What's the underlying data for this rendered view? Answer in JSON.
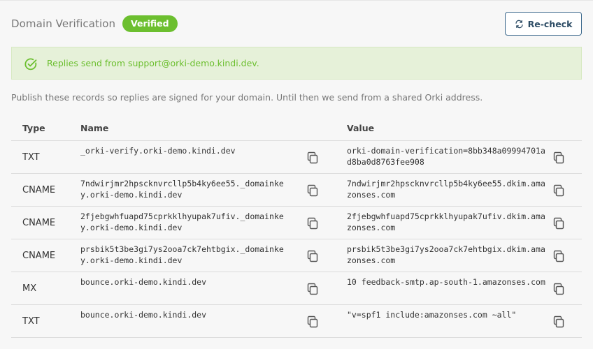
{
  "header": {
    "title": "Domain Verification",
    "status_badge": "Verified",
    "recheck_label": "Re-check"
  },
  "alert": {
    "message": "Replies send from support@orki-demo.kindi.dev."
  },
  "description": "Publish these records so replies are signed for your domain. Until then we send from a shared Orki address.",
  "table": {
    "columns": {
      "type": "Type",
      "name": "Name",
      "value": "Value"
    },
    "rows": [
      {
        "type": "TXT",
        "name": "_orki-verify.orki-demo.kindi.dev",
        "value": "orki-domain-verification=8bb348a09994701ad8ba0d8763fee908"
      },
      {
        "type": "CNAME",
        "name": "7ndwirjmr2hpscknvrcllp5b4ky6ee55._domainkey.orki-demo.kindi.dev",
        "value": "7ndwirjmr2hpscknvrcllp5b4ky6ee55.dkim.amazonses.com"
      },
      {
        "type": "CNAME",
        "name": "2fjebgwhfuapd75cprkklhyupak7ufiv._domainkey.orki-demo.kindi.dev",
        "value": "2fjebgwhfuapd75cprkklhyupak7ufiv.dkim.amazonses.com"
      },
      {
        "type": "CNAME",
        "name": "prsbik5t3be3gi7ys2ooa7ck7ehtbgix._domainkey.orki-demo.kindi.dev",
        "value": "prsbik5t3be3gi7ys2ooa7ck7ehtbgix.dkim.amazonses.com"
      },
      {
        "type": "MX",
        "name": "bounce.orki-demo.kindi.dev",
        "value": "10 feedback-smtp.ap-south-1.amazonses.com"
      },
      {
        "type": "TXT",
        "name": "bounce.orki-demo.kindi.dev",
        "value": "\"v=spf1 include:amazonses.com ~all\""
      }
    ]
  },
  "icons": {
    "recheck": "refresh-arrows-icon",
    "alert": "check-circle-icon",
    "copy": "copy-icon"
  },
  "colors": {
    "verified_green": "#6cbf2f",
    "alert_bg": "#e6f1d9",
    "button_border": "#3f6b8e",
    "muted_text": "#777777"
  }
}
